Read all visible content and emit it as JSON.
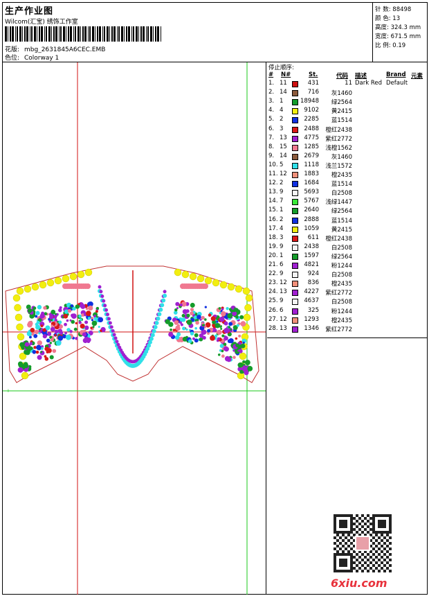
{
  "header": {
    "title": "生产作业图",
    "company": "Wilcom(汇宝) 绣饰工作室",
    "file_label": "花版:",
    "file_name": "mbg_2631845A6CEC.EMB",
    "colorway_label": "色位:",
    "colorway": "Colorway 1"
  },
  "stats": [
    {
      "label": "针 数:",
      "value": "88498"
    },
    {
      "label": "颜 色:",
      "value": "13"
    },
    {
      "label": "高度:",
      "value": "324.3 mm"
    },
    {
      "label": "宽度:",
      "value": "671.5 mm"
    },
    {
      "label": "比 例:",
      "value": "0.19"
    }
  ],
  "sequence": {
    "title": "停止顺序:",
    "headers": {
      "num": "#",
      "needle": "N#",
      "stitches": "St.",
      "code": "代码",
      "desc": "描述",
      "brand": "Brand",
      "elem": "元素"
    },
    "rows": [
      {
        "no": "1.",
        "n": "11",
        "color": "#cc1010",
        "st": "431",
        "code": "11",
        "desc": "Dark Red",
        "brand": "Default"
      },
      {
        "no": "2.",
        "n": "14",
        "color": "#8b5a3c",
        "st": "716",
        "code": "灰1460",
        "desc": "",
        "brand": ""
      },
      {
        "no": "3.",
        "n": "1",
        "color": "#149b2a",
        "st": "18948",
        "code": "绿2564",
        "desc": "",
        "brand": ""
      },
      {
        "no": "4.",
        "n": "4",
        "color": "#f2ee10",
        "st": "9102",
        "code": "黄2415",
        "desc": "",
        "brand": ""
      },
      {
        "no": "5.",
        "n": "2",
        "color": "#1030e0",
        "st": "2285",
        "code": "蓝1514",
        "desc": "",
        "brand": ""
      },
      {
        "no": "6.",
        "n": "3",
        "color": "#d81818",
        "st": "2488",
        "code": "橙红2438",
        "desc": "",
        "brand": ""
      },
      {
        "no": "7.",
        "n": "13",
        "color": "#a020d0",
        "st": "4775",
        "code": "紫红2772",
        "desc": "",
        "brand": ""
      },
      {
        "no": "8.",
        "n": "15",
        "color": "#f07890",
        "st": "1285",
        "code": "浅橙1562",
        "desc": "",
        "brand": ""
      },
      {
        "no": "9.",
        "n": "14",
        "color": "#8b5a3c",
        "st": "2679",
        "code": "灰1460",
        "desc": "",
        "brand": ""
      },
      {
        "no": "10.",
        "n": "5",
        "color": "#30e0e8",
        "st": "1118",
        "code": "浅兰1572",
        "desc": "",
        "brand": ""
      },
      {
        "no": "11.",
        "n": "12",
        "color": "#f0907a",
        "st": "1883",
        "code": "橙2435",
        "desc": "",
        "brand": ""
      },
      {
        "no": "12.",
        "n": "2",
        "color": "#1030e0",
        "st": "1684",
        "code": "蓝1514",
        "desc": "",
        "brand": ""
      },
      {
        "no": "13.",
        "n": "9",
        "color": "#f4f4f4",
        "st": "5693",
        "code": "白2508",
        "desc": "",
        "brand": ""
      },
      {
        "no": "14.",
        "n": "7",
        "color": "#38e838",
        "st": "5767",
        "code": "浅绿1447",
        "desc": "",
        "brand": ""
      },
      {
        "no": "15.",
        "n": "1",
        "color": "#149b2a",
        "st": "2640",
        "code": "绿2564",
        "desc": "",
        "brand": ""
      },
      {
        "no": "16.",
        "n": "2",
        "color": "#1030e0",
        "st": "2888",
        "code": "蓝1514",
        "desc": "",
        "brand": ""
      },
      {
        "no": "17.",
        "n": "4",
        "color": "#f2ee10",
        "st": "1059",
        "code": "黄2415",
        "desc": "",
        "brand": ""
      },
      {
        "no": "18.",
        "n": "3",
        "color": "#d81818",
        "st": "611",
        "code": "橙红2438",
        "desc": "",
        "brand": ""
      },
      {
        "no": "19.",
        "n": "9",
        "color": "#f4f4f4",
        "st": "2438",
        "code": "白2508",
        "desc": "",
        "brand": ""
      },
      {
        "no": "20.",
        "n": "1",
        "color": "#149b2a",
        "st": "1597",
        "code": "绿2564",
        "desc": "",
        "brand": ""
      },
      {
        "no": "21.",
        "n": "6",
        "color": "#a020d0",
        "st": "4821",
        "code": "粉1244",
        "desc": "",
        "brand": ""
      },
      {
        "no": "22.",
        "n": "9",
        "color": "#f4f4f4",
        "st": "924",
        "code": "白2508",
        "desc": "",
        "brand": ""
      },
      {
        "no": "23.",
        "n": "12",
        "color": "#f0907a",
        "st": "836",
        "code": "橙2435",
        "desc": "",
        "brand": ""
      },
      {
        "no": "24.",
        "n": "13",
        "color": "#a020d0",
        "st": "4227",
        "code": "紫红2772",
        "desc": "",
        "brand": ""
      },
      {
        "no": "25.",
        "n": "9",
        "color": "#f4f4f4",
        "st": "4637",
        "code": "白2508",
        "desc": "",
        "brand": ""
      },
      {
        "no": "26.",
        "n": "6",
        "color": "#a020d0",
        "st": "325",
        "code": "粉1244",
        "desc": "",
        "brand": ""
      },
      {
        "no": "27.",
        "n": "12",
        "color": "#f0907a",
        "st": "1293",
        "code": "橙2435",
        "desc": "",
        "brand": ""
      },
      {
        "no": "28.",
        "n": "13",
        "color": "#a020d0",
        "st": "1346",
        "code": "紫红2772",
        "desc": "",
        "brand": ""
      }
    ]
  },
  "watermark": {
    "brand": "6xiu.com",
    "icon": "qr-code-icon",
    "color": "#e8323c"
  },
  "guides": {
    "red": "#d01010",
    "green": "#18c818"
  }
}
